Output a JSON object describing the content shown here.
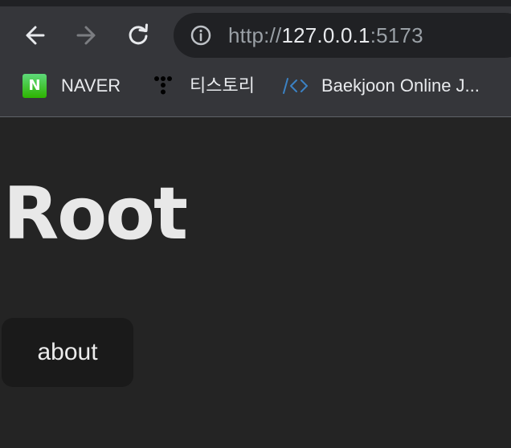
{
  "toolbar": {
    "back_icon": "arrow-left-icon",
    "forward_icon": "arrow-right-icon",
    "reload_icon": "reload-icon"
  },
  "address_bar": {
    "info_icon": "info-icon",
    "scheme": "http://",
    "host": "127.0.0.1",
    "port": ":5173"
  },
  "bookmarks": {
    "naver": {
      "label": "NAVER",
      "icon_letter": "N"
    },
    "tistory": {
      "label": "티스토리"
    },
    "baekjoon": {
      "label": "Baekjoon Online J..."
    }
  },
  "page": {
    "title": "Root",
    "about_button": "about"
  },
  "colors": {
    "chrome_background": "#35363a",
    "omnibox_background": "#202124",
    "page_background": "#242424",
    "button_background": "#1a1a1a",
    "naver_green": "#2db400",
    "baekjoon_blue": "#3b82c4"
  }
}
